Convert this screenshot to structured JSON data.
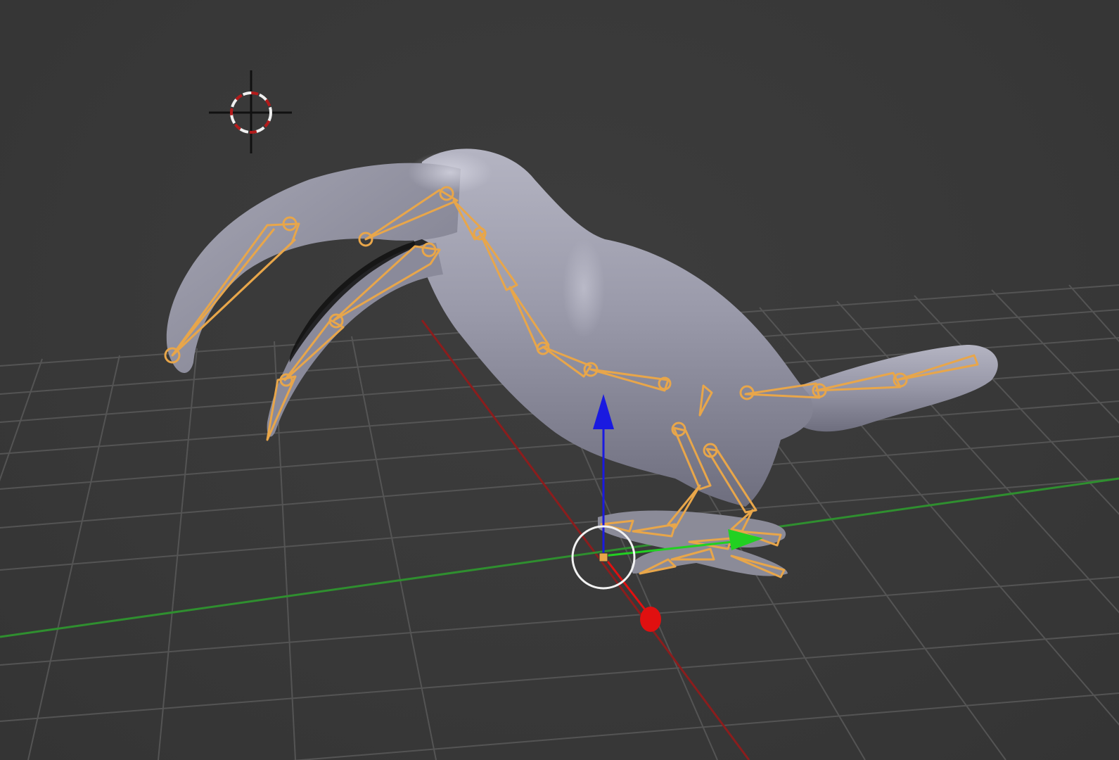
{
  "viewport": {
    "background_color": "#393939",
    "grid_color": "#5a5a5a",
    "x_axis_color": "#8b1d1d",
    "y_axis_color": "#2f8f2f",
    "mesh": "toucan",
    "mesh_color": "#9a9aa8",
    "armature_color": "#e8a64a",
    "cursor_icon": "3d-cursor-icon",
    "transform_gizmo": {
      "x_color": "#e01010",
      "y_color": "#22d022",
      "z_color": "#1a1ae0",
      "pivot_color": "#e8a64a"
    }
  }
}
